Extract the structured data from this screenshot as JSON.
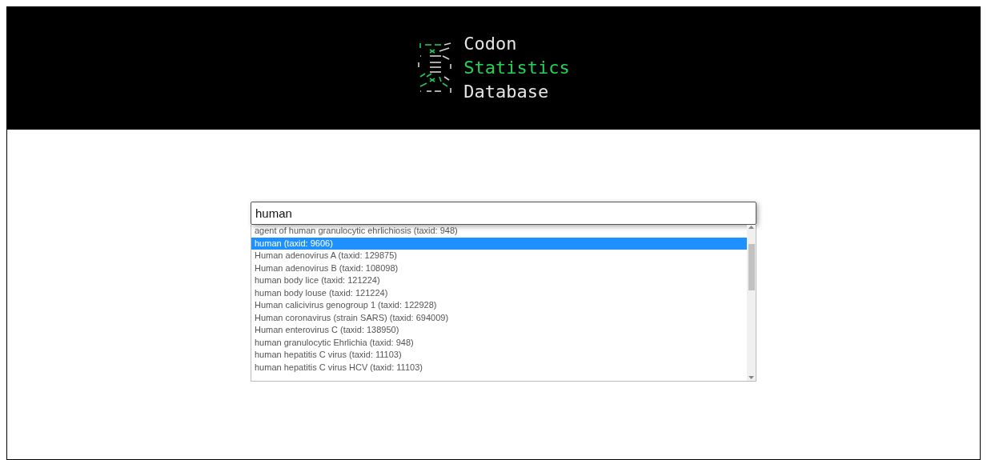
{
  "logo": {
    "lines": [
      {
        "text": "Codon",
        "kind": "plain"
      },
      {
        "text": "Statistics",
        "kind": "accent"
      },
      {
        "text": "Database",
        "kind": "plain"
      }
    ]
  },
  "search": {
    "value": "human"
  },
  "suggestions": [
    {
      "label": "agent of human granulocytic ehrlichiosis (taxid: 948)",
      "selected": false
    },
    {
      "label": "human (taxid: 9606)",
      "selected": true
    },
    {
      "label": "Human adenovirus A (taxid: 129875)",
      "selected": false
    },
    {
      "label": "Human adenovirus B (taxid: 108098)",
      "selected": false
    },
    {
      "label": "human body lice (taxid: 121224)",
      "selected": false
    },
    {
      "label": "human body louse (taxid: 121224)",
      "selected": false
    },
    {
      "label": "Human calicivirus genogroup 1 (taxid: 122928)",
      "selected": false
    },
    {
      "label": "Human coronavirus (strain SARS) (taxid: 694009)",
      "selected": false
    },
    {
      "label": "Human enterovirus C (taxid: 138950)",
      "selected": false
    },
    {
      "label": "human granulocytic Ehrlichia (taxid: 948)",
      "selected": false
    },
    {
      "label": "human hepatitis C virus (taxid: 11103)",
      "selected": false
    },
    {
      "label": "human hepatitis C virus HCV (taxid: 11103)",
      "selected": false
    }
  ]
}
